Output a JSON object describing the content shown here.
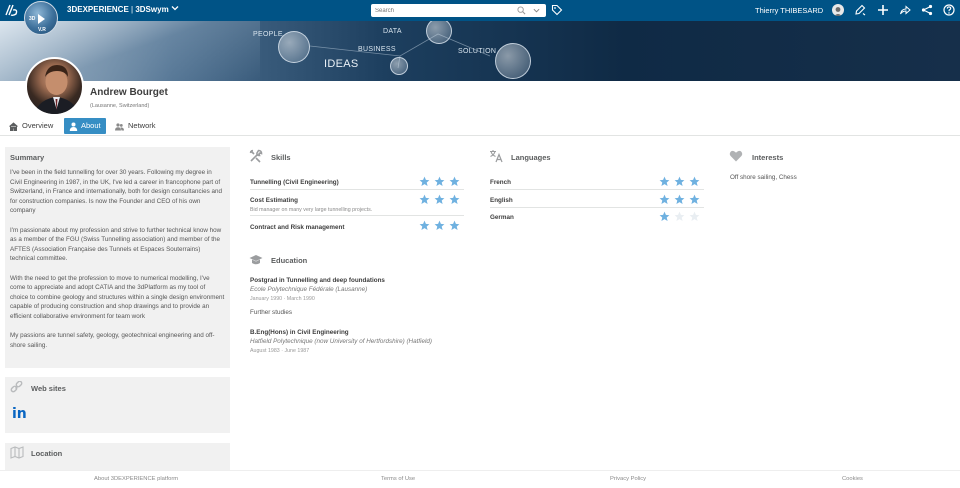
{
  "topbar": {
    "brand_prefix": "3DEXPERIENCE",
    "brand_separator": " | ",
    "brand_app": "3DSwym",
    "compass_labels": {
      "left": "3D",
      "bottom": "V.R"
    },
    "search_placeholder": "Search",
    "user_name": "Thierry THIBESARD",
    "colors": {
      "bar": "#005386",
      "accent": "#368ec4"
    }
  },
  "banner": {
    "words": [
      "PEOPLE",
      "DATA",
      "BUSINESS",
      "SOLUTION",
      "IDEAS"
    ]
  },
  "profile": {
    "name": "Andrew Bourget",
    "location": "(Lausanne, Switzerland)"
  },
  "tabs": [
    {
      "label": "Overview",
      "icon": "home-icon",
      "active": false
    },
    {
      "label": "About",
      "icon": "user-icon",
      "active": true
    },
    {
      "label": "Network",
      "icon": "network-icon",
      "active": false
    }
  ],
  "summary": {
    "title": "Summary",
    "paragraphs": [
      "I've been in the field tunnelling for over 30 years. Following my degree in Civil Engineering in 1987, in the UK, I've led a career in francophone part of Switzerland, in France and internationally, both for design consultancies and for construction companies. Is now the Founder and CEO of his own company",
      "I'm passionate about my profession and strive to further technical know how as a member of the FGU (Swiss Tunnelling association) and member of the AFTES (Association Française des Tunnels et Espaces Souterrains) technical committee.",
      "With the need to get the profession to move to numerical modelling, I've come to appreciate and adopt CATIA and the 3dPlatform as my tool of choice to combine geology and structures within a single design environment capable of producing construction and shop drawings and to provide an efficient collaborative environment for team work",
      "My passions are tunnel safety, geology, geotechnical engineering and off-shore sailing."
    ]
  },
  "websites": {
    "title": "Web sites",
    "linkedin_label": "in"
  },
  "location": {
    "title": "Location"
  },
  "skills": {
    "title": "Skills",
    "items": [
      {
        "name": "Tunnelling (Civil Engineering)",
        "description": "",
        "rating": 3
      },
      {
        "name": "Cost Estimating",
        "description": "Bid manager on many very large tunnelling projects.",
        "rating": 3
      },
      {
        "name": "Contract and Risk management",
        "description": "",
        "rating": 3
      }
    ]
  },
  "languages": {
    "title": "Languages",
    "items": [
      {
        "name": "French",
        "rating": 3
      },
      {
        "name": "English",
        "rating": 3
      },
      {
        "name": "German",
        "rating": 1
      }
    ]
  },
  "interests": {
    "title": "Interests",
    "text": "Off shore sailing, Chess"
  },
  "education": {
    "title": "Education",
    "items": [
      {
        "degree": "Postgrad in Tunnelling and deep foundations",
        "school": "Ecole Polytechnique Fédérale (Lausanne)",
        "dates": "January 1990 · March 1990",
        "extra": "Further studies"
      },
      {
        "degree": "B.Eng(Hons) in Civil Engineering",
        "school": "Hatfield Polytechnique (now University of Hertfordshire) (Hatfield)",
        "dates": "August 1983 · June 1987",
        "extra": ""
      }
    ]
  },
  "footer": {
    "links": [
      "About 3DEXPERIENCE platform",
      "Terms of Use",
      "Privacy Policy",
      "Cookies"
    ]
  },
  "star_colors": {
    "filled": "#6fb1e0",
    "empty": "#e9eef2"
  }
}
